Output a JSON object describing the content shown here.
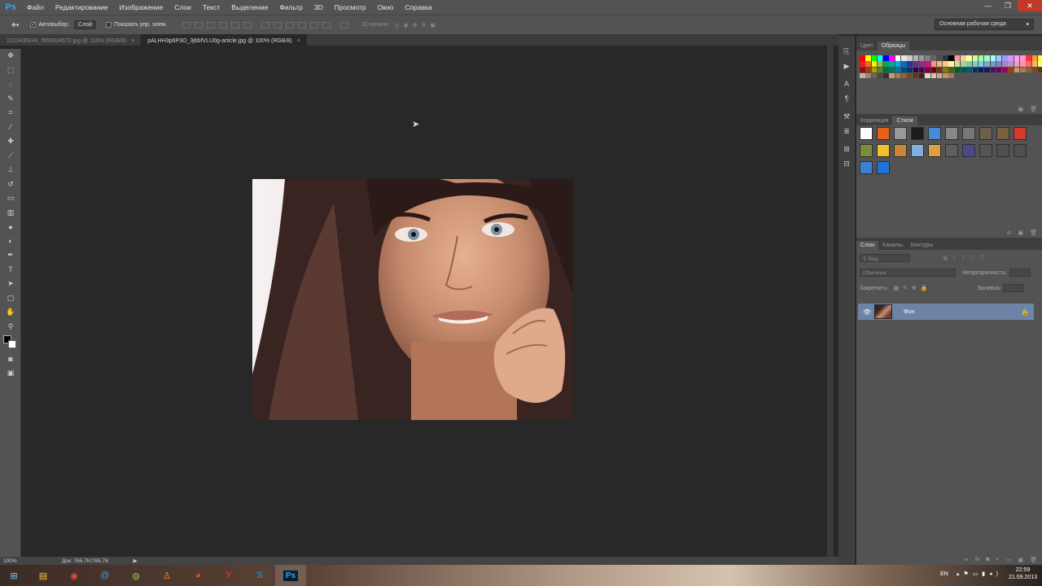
{
  "app": {
    "logo": "Ps"
  },
  "menu": [
    "Файл",
    "Редактирование",
    "Изображение",
    "Слои",
    "Текст",
    "Выделение",
    "Фильтр",
    "3D",
    "Просмотр",
    "Окно",
    "Справка"
  ],
  "window_controls": {
    "minimize": "—",
    "restore": "❐",
    "close": "✕"
  },
  "options": {
    "autoselect_label": "Автовыбор:",
    "autoselect_value": "Слой",
    "show_controls_label": "Показать упр. элем.",
    "mode_3d": "3D-режим:",
    "workspace": "Основная рабочая среда"
  },
  "tabs": [
    {
      "label": "2223435244_f893024672.jpg @ 110% (RGB/8)",
      "close": "×"
    },
    {
      "label": "pALHH3p6P3O_3j6bfVLU0g-article.jpg @ 100% (RGB/8)",
      "close": "×"
    }
  ],
  "status": {
    "zoom": "100%",
    "doc": "Док: 765,7K/765,7K"
  },
  "panels": {
    "color_tab": "Цвет",
    "swatches_tab": "Образцы",
    "adjustments_tab": "Коррекция",
    "styles_tab": "Стили",
    "layers_tab": "Слои",
    "channels_tab": "Каналы",
    "paths_tab": "Контуры",
    "kind_filter": "Вид",
    "blend_mode": "Обычные",
    "opacity_label": "Непрозрачность:",
    "lock_label": "Закрепить:",
    "fill_label": "Заливка:",
    "layer_name": "Фон"
  },
  "swatch_colors": [
    "#ff0000",
    "#ffff00",
    "#00ff00",
    "#00ffff",
    "#0000ff",
    "#ff00ff",
    "#ffffff",
    "#e6e6e6",
    "#cccccc",
    "#b3b3b3",
    "#999999",
    "#808080",
    "#666666",
    "#4d4d4d",
    "#333333",
    "#000000",
    "#ff9999",
    "#ffcc99",
    "#ffff99",
    "#ccff99",
    "#99ff99",
    "#99ffcc",
    "#99ffff",
    "#99ccff",
    "#9999ff",
    "#cc99ff",
    "#ff99ff",
    "#ff99cc",
    "#ff3333",
    "#ff9933",
    "#ffff33",
    "#99ff33",
    "#ed1c24",
    "#f26522",
    "#fff200",
    "#8dc63f",
    "#00a651",
    "#00a99d",
    "#00aeef",
    "#0072bc",
    "#2e3192",
    "#662d91",
    "#92278f",
    "#ec008c",
    "#f7977a",
    "#f9ad81",
    "#fdc68a",
    "#fff79a",
    "#c4df9b",
    "#a3d39c",
    "#82ca9d",
    "#7bcdc8",
    "#6ecff6",
    "#7ea7d8",
    "#8493ca",
    "#8882be",
    "#a187be",
    "#bc8dbf",
    "#f49ac2",
    "#f6989d",
    "#ff6666",
    "#ffb366",
    "#ffff66",
    "#b3ff66",
    "#9e0b0f",
    "#a0410d",
    "#aba000",
    "#598527",
    "#007236",
    "#00746b",
    "#0076a3",
    "#004a80",
    "#003471",
    "#32004b",
    "#4b0049",
    "#7b0046",
    "#790000",
    "#7b2e00",
    "#827b00",
    "#406618",
    "#005e20",
    "#005952",
    "#005b7f",
    "#003663",
    "#002157",
    "#1b1464",
    "#440e62",
    "#630460",
    "#9e005d",
    "#a0410d",
    "#c69c6d",
    "#a67c52",
    "#8c6239",
    "#754c24",
    "#603913",
    "#3c2415",
    "#c7b299",
    "#998675",
    "#736357",
    "#534741",
    "#362f2d",
    "#c69c6d",
    "#a67c52",
    "#8c6239",
    "#754c24",
    "#603913",
    "#3c2415",
    "#e6d6c0",
    "#d9c2a5",
    "#cca98a",
    "#bf9169",
    "#a8784f"
  ],
  "style_colors": [
    "#ffffff",
    "#e8601c",
    "#999999",
    "#1d1d1d",
    "#4b8ad6",
    "#888888",
    "#777777",
    "#6d5f4a",
    "#7a6040",
    "#d33a2c",
    "#7e8c3a",
    "#f2c12e",
    "#c8863a",
    "#7fb0e0",
    "#dca03c",
    "#5f5f5f",
    "#4a4a8a",
    "#555555",
    "#4f4f4f",
    "#505050",
    "#3d7fd4",
    "#1e73d8"
  ],
  "taskbar": {
    "ps_label": "Ps",
    "lang": "EN",
    "time": "22:59",
    "date": "21.09.2013"
  }
}
